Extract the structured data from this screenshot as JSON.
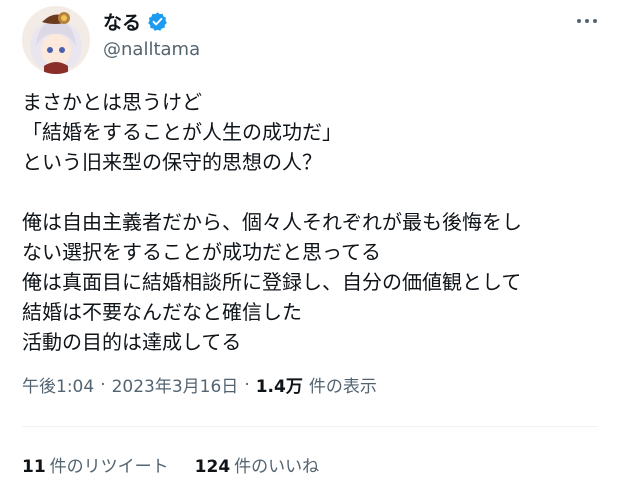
{
  "author": {
    "display_name": "なる",
    "handle": "@nalltama",
    "verified_color": "#1d9bf0"
  },
  "tweet": {
    "lines": [
      "まさかとは思うけど",
      "「結婚をすることが人生の成功だ」",
      "という旧来型の保守的思想の人？",
      "",
      "俺は自由主義者だから、個々人それぞれが最も後悔をし",
      "ない選択をすることが成功だと思ってる",
      "俺は真面目に結婚相談所に登録し、自分の価値観として",
      "結婚は不要なんだなと確信した",
      "活動の目的は達成してる"
    ]
  },
  "meta": {
    "time": "午後1:04",
    "separator": "·",
    "date": "2023年3月16日",
    "views_count": "1.4万",
    "views_label": "件の表示"
  },
  "stats": {
    "retweets_count": "11",
    "retweets_label": "件のリツイート",
    "likes_count": "124",
    "likes_label": "件のいいね"
  },
  "icons": {
    "more": "more-icon",
    "verified": "verified-badge-icon"
  }
}
